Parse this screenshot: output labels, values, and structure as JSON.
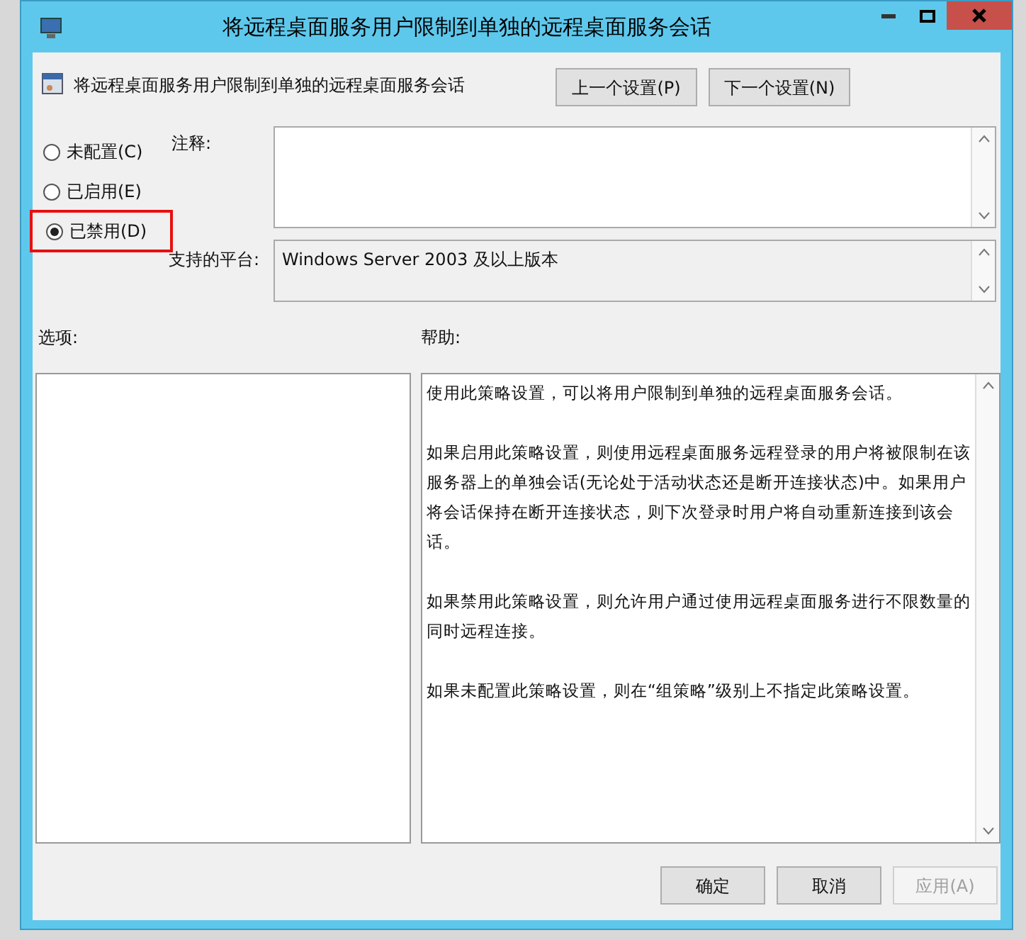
{
  "window": {
    "title": "将远程桌面服务用户限制到单独的远程桌面服务会话"
  },
  "header": {
    "policy_name": "将远程桌面服务用户限制到单独的远程桌面服务会话",
    "buttons": [
      "上一个设置(P)",
      "下一个设置(N)"
    ]
  },
  "options": [
    {
      "label": "未配置(C)",
      "selected": false,
      "highlighted": false
    },
    {
      "label": "已启用(E)",
      "selected": false,
      "highlighted": false
    },
    {
      "label": "已禁用(D)",
      "selected": true,
      "highlighted": true
    }
  ],
  "comment": {
    "label": "注释:"
  },
  "platform": {
    "label": "支持的平台:",
    "value": "Windows Server 2003 及以上版本"
  },
  "options_label": "选项:",
  "help": {
    "label": "帮助:",
    "paragraphs": [
      "使用此策略设置，可以将用户限制到单独的远程桌面服务会话。",
      "如果启用此策略设置，则使用远程桌面服务远程登录的用户将被限制在该服务器上的单独会话(无论处于活动状态还是断开连接状态)中。如果用户将会话保持在断开连接状态，则下次登录时用户将自动重新连接到该会话。",
      "如果禁用此策略设置，则允许用户通过使用远程桌面服务进行不限数量的同时远程连接。",
      "如果未配置此策略设置，则在“组策略”级别上不指定此策略设置。"
    ]
  },
  "footer_buttons": [
    {
      "label": "确定",
      "disabled": false
    },
    {
      "label": "取消",
      "disabled": false
    },
    {
      "label": "应用(A)",
      "disabled": true
    }
  ]
}
